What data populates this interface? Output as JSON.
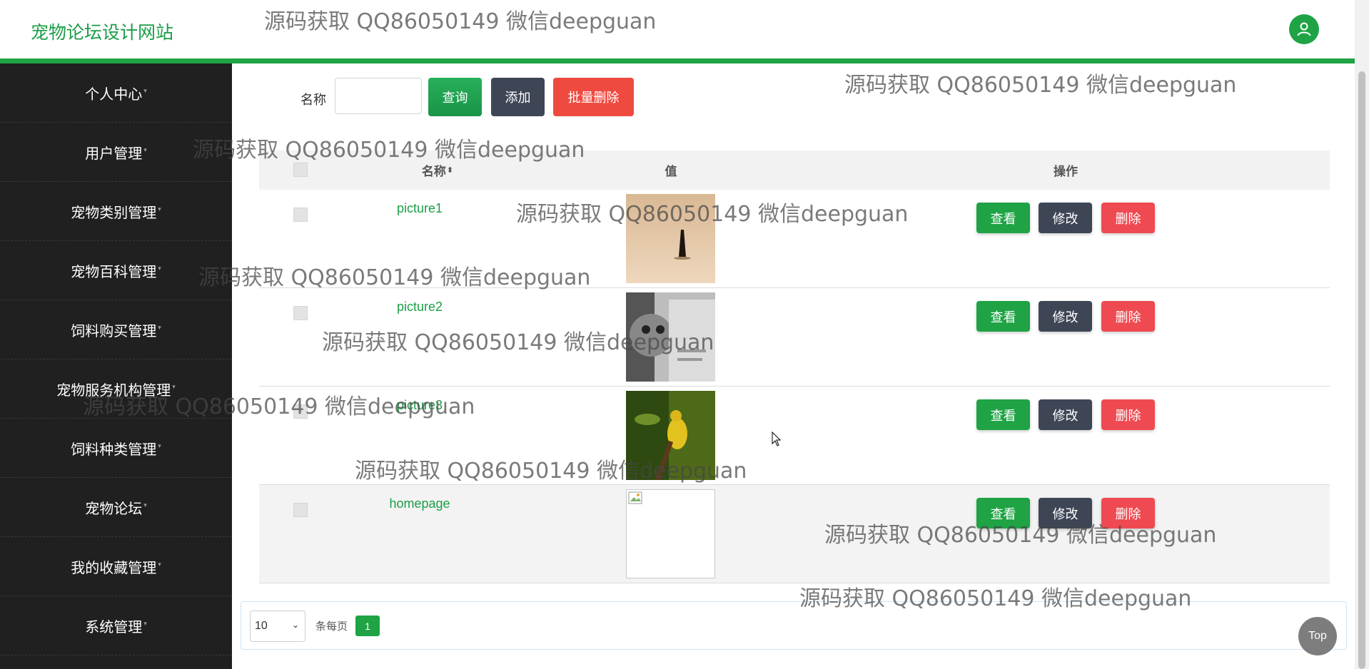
{
  "header": {
    "title": "宠物论坛设计网站",
    "avatar_icon": "user-icon",
    "accent": "#1fa345"
  },
  "sidebar": {
    "items": [
      {
        "label": "个人中心"
      },
      {
        "label": "用户管理"
      },
      {
        "label": "宠物类别管理"
      },
      {
        "label": "宠物百科管理"
      },
      {
        "label": "饲料购买管理"
      },
      {
        "label": "宠物服务机构管理"
      },
      {
        "label": "饲料种类管理"
      },
      {
        "label": "宠物论坛"
      },
      {
        "label": "我的收藏管理"
      },
      {
        "label": "系统管理"
      }
    ]
  },
  "toolbar": {
    "search_label": "名称",
    "search_value": "",
    "query_label": "查询",
    "add_label": "添加",
    "batch_delete_label": "批量删除"
  },
  "table": {
    "headers": {
      "name": "名称",
      "value": "值",
      "actions": "操作"
    },
    "rows": [
      {
        "name": "picture1",
        "view": "查看",
        "edit": "修改",
        "delete": "删除"
      },
      {
        "name": "picture2",
        "view": "查看",
        "edit": "修改",
        "delete": "删除"
      },
      {
        "name": "picture3",
        "view": "查看",
        "edit": "修改",
        "delete": "删除"
      },
      {
        "name": "homepage",
        "view": "查看",
        "edit": "修改",
        "delete": "删除"
      }
    ]
  },
  "pager": {
    "page_size": "10",
    "per_page_label": "条每页",
    "current_page": "1"
  },
  "top_button": "Top",
  "watermark": "源码获取 QQ86050149 微信deepguan"
}
